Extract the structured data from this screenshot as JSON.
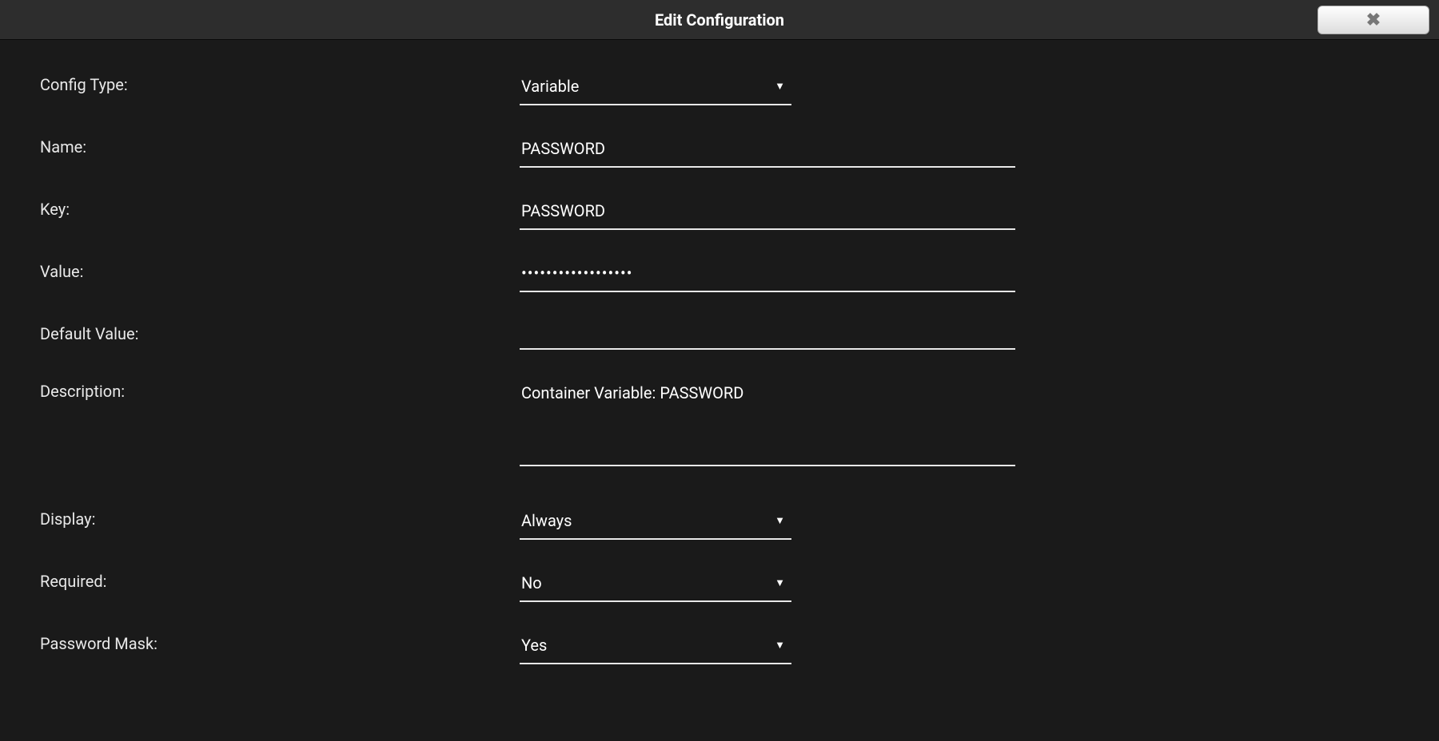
{
  "dialog": {
    "title": "Edit Configuration",
    "close_icon": "✖"
  },
  "form": {
    "config_type": {
      "label": "Config Type:",
      "value": "Variable"
    },
    "name": {
      "label": "Name:",
      "value": "PASSWORD"
    },
    "key": {
      "label": "Key:",
      "value": "PASSWORD"
    },
    "value": {
      "label": "Value:",
      "masked": "••••••••••••••••••"
    },
    "default_value": {
      "label": "Default Value:",
      "value": ""
    },
    "description": {
      "label": "Description:",
      "value": "Container Variable: PASSWORD"
    },
    "display": {
      "label": "Display:",
      "value": "Always"
    },
    "required": {
      "label": "Required:",
      "value": "No"
    },
    "password_mask": {
      "label": "Password Mask:",
      "value": "Yes"
    }
  }
}
